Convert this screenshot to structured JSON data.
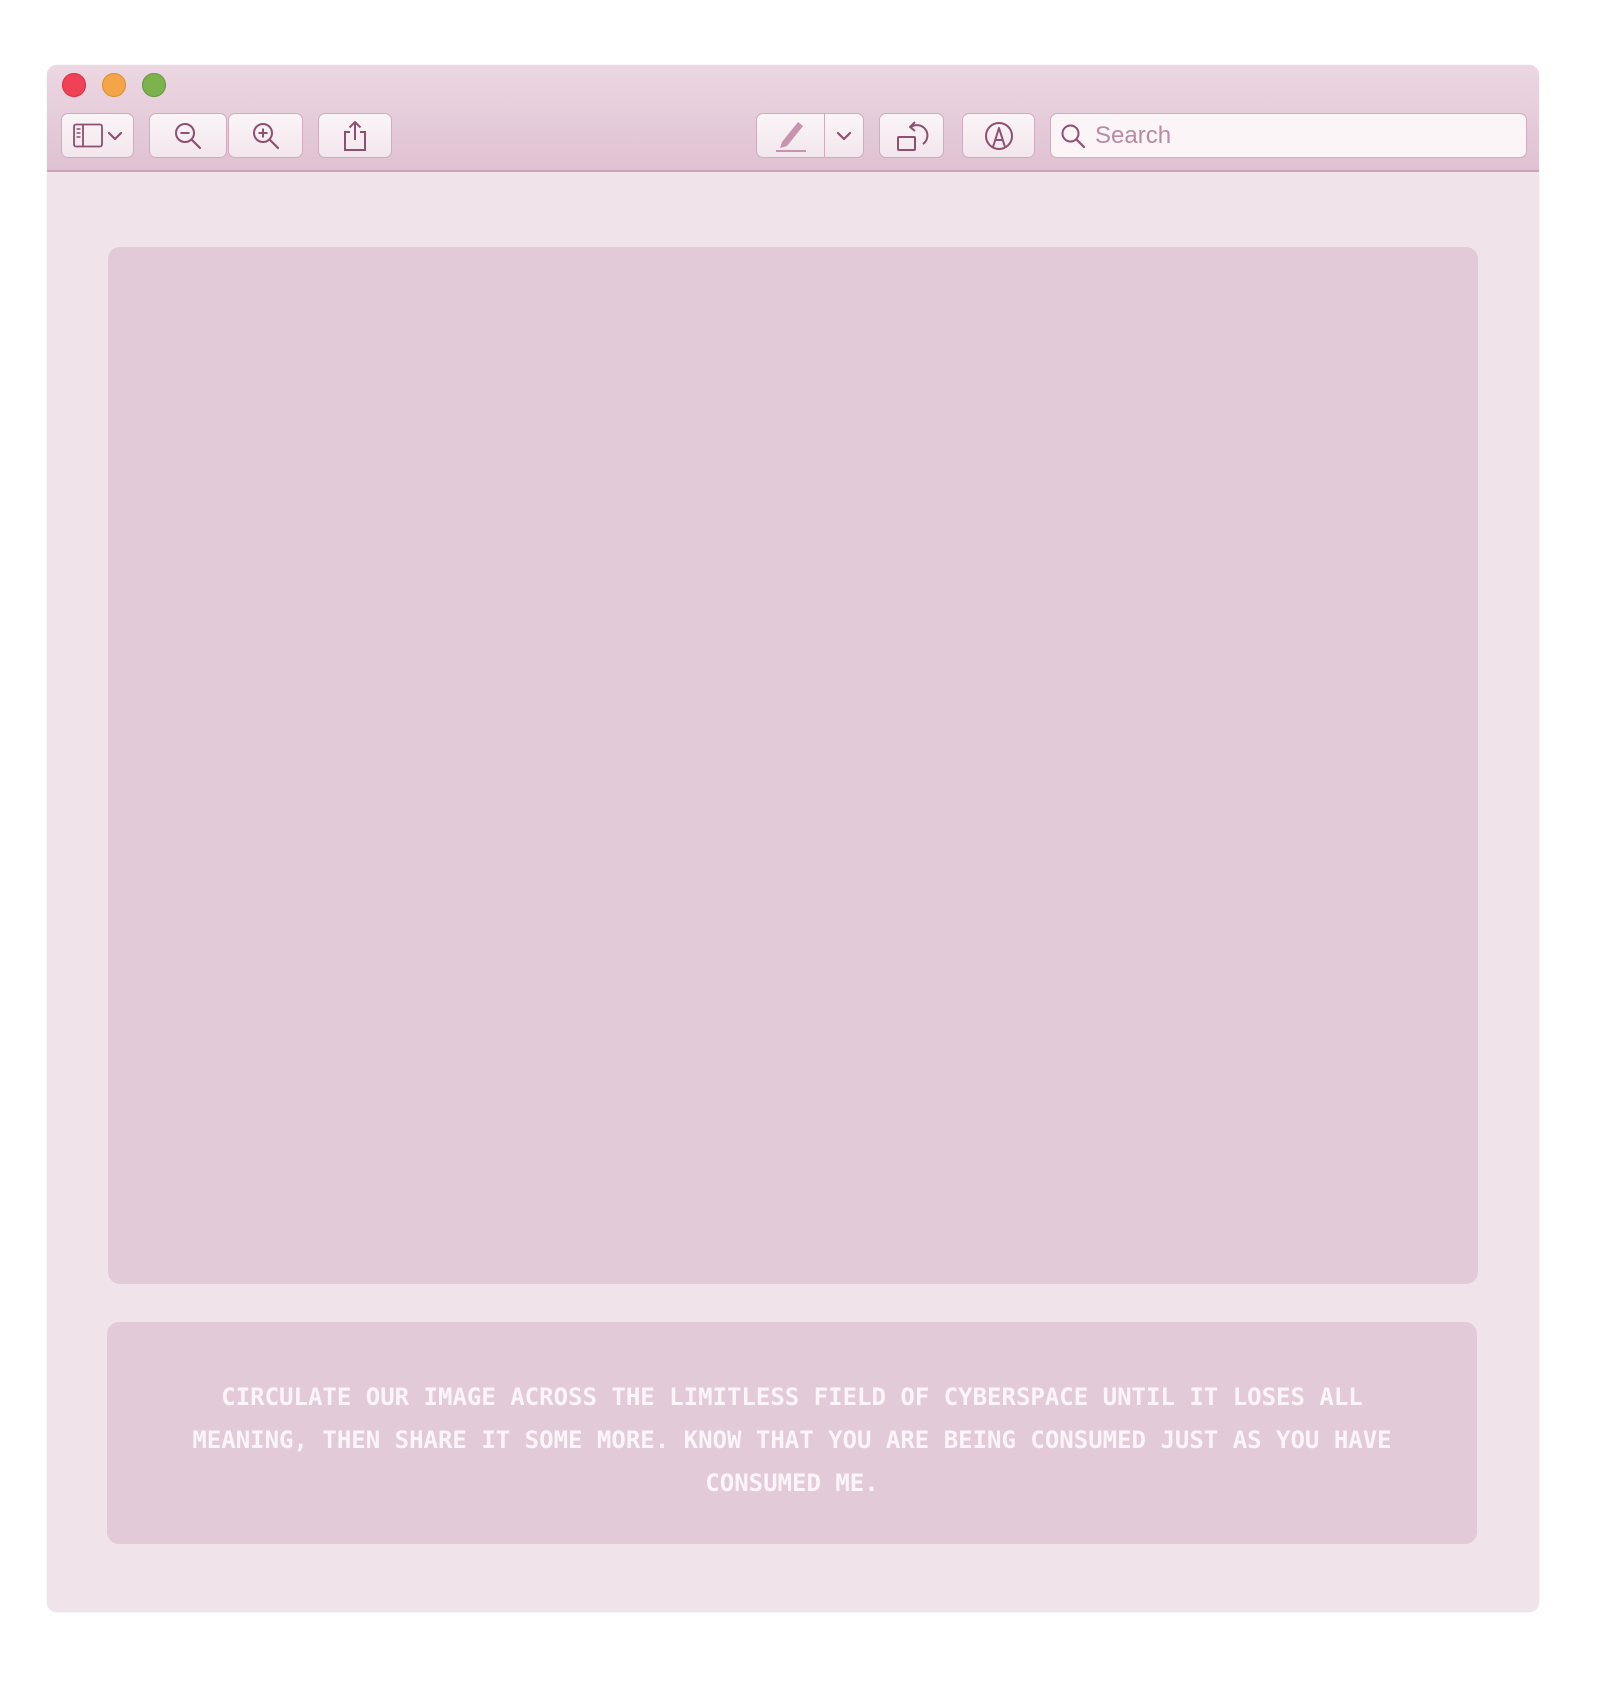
{
  "window": {
    "title": ""
  },
  "toolbar": {
    "sidebar_icon": "sidebar-icon",
    "zoom_out_icon": "zoom-out-icon",
    "zoom_in_icon": "zoom-in-icon",
    "share_icon": "share-icon",
    "pen_icon": "pen-icon",
    "rotate_icon": "rotate-icon",
    "markup_icon": "markup-icon"
  },
  "search": {
    "placeholder": "Search",
    "value": ""
  },
  "caption": {
    "text": "CIRCULATE OUR IMAGE ACROSS THE LIMITLESS FIELD OF CYBERSPACE UNTIL IT LOSES ALL MEANING, THEN SHARE IT SOME MORE. KNOW THAT YOU ARE BEING CONSUMED JUST AS YOU HAVE CONSUMED ME."
  },
  "colors": {
    "accent": "#8f4f70",
    "window_bg": "#f1e3ea",
    "panel_bg": "#e2cad8",
    "close": "#ef4257",
    "minimize": "#f3a548",
    "maximize": "#7cb24e"
  }
}
